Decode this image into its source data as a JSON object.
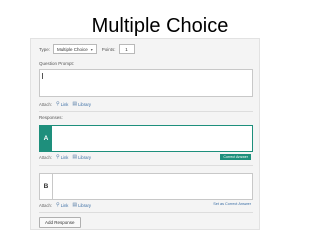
{
  "slide": {
    "title": "Multiple Choice"
  },
  "form": {
    "type_label": "Type:",
    "type_value": "Multiple Choice",
    "points_label": "Points:",
    "points_value": "1",
    "question_label": "Question Prompt:",
    "attach_label": "Attach:",
    "attach_link": "Link",
    "attach_library": "Library",
    "responses_label": "Responses:",
    "responses": [
      {
        "letter": "A",
        "status": "Correct Answer",
        "correct": true
      },
      {
        "letter": "B",
        "status": "Set as Correct Answer",
        "correct": false
      }
    ],
    "add_response": "Add Response"
  },
  "icons": {
    "link": "link-icon",
    "library": "library-icon",
    "dropdown": "chevron-down-icon"
  },
  "colors": {
    "accent": "#1e8f7c",
    "link": "#3a6ea5",
    "page_bg": "#f4f4f4"
  }
}
